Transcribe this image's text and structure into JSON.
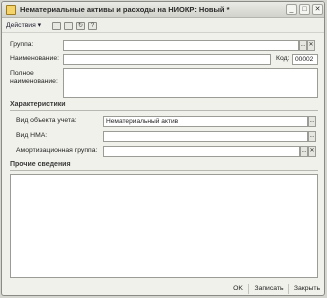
{
  "window": {
    "title": "Нематериальные активы и расходы на НИОКР: Новый *",
    "minimize_glyph": "_",
    "maximize_glyph": "□",
    "close_glyph": "✕"
  },
  "toolbar": {
    "actions_label": "Действия ▾",
    "icons": [
      "document-icon",
      "copy-icon",
      "refresh-icon",
      "help-icon"
    ]
  },
  "form": {
    "group_label": "Группа:",
    "group_value": "",
    "name_label": "Наименование:",
    "name_value": "",
    "code_label": "Код:",
    "code_value": "00002",
    "full_name_label_1": "Полное",
    "full_name_label_2": "наименование:",
    "full_name_value": "",
    "ellipsis": "...",
    "clear_glyph": "✕"
  },
  "characteristics": {
    "section_title": "Характеристики",
    "object_type_label": "Вид объекта учета:",
    "object_type_value": "Нематериальный актив",
    "nma_type_label": "Вид НМА:",
    "nma_type_value": "",
    "amortization_label": "Амортизационная группа:",
    "amortization_value": ""
  },
  "other": {
    "section_title": "Прочие сведения"
  },
  "footer": {
    "ok_label": "OK",
    "save_label": "Записать",
    "close_label": "Закрыть"
  }
}
